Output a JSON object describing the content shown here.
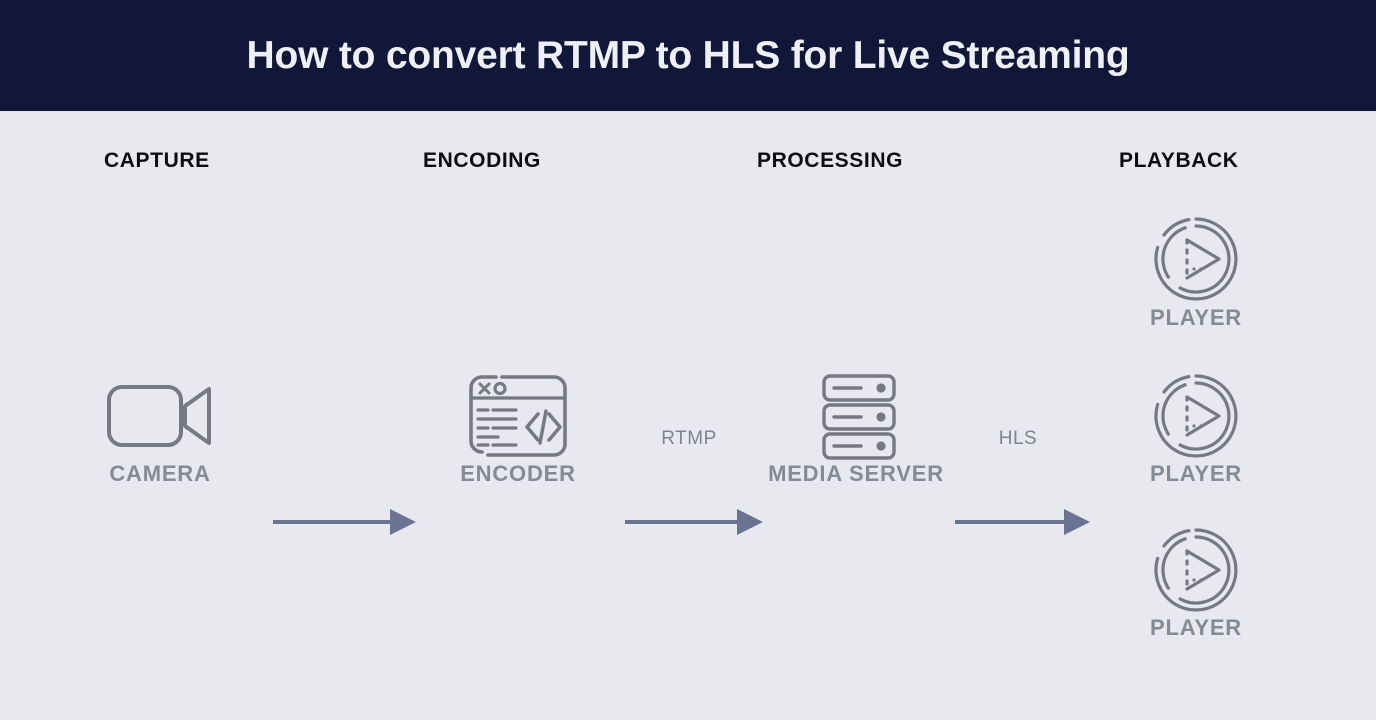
{
  "header": {
    "title": "How to convert RTMP to HLS for Live Streaming",
    "background_color": "#111738",
    "text_color": "#eef0f6"
  },
  "canvas": {
    "background_color": "#e8e9ee"
  },
  "colors": {
    "stage_header_text": "#0b0c10",
    "node_label_text": "#858a93",
    "icon_stroke": "#76797f",
    "arrow": "#6b7392",
    "arrow_label_text": "#7f848d"
  },
  "stages": [
    {
      "id": "capture",
      "label": "CAPTURE"
    },
    {
      "id": "encoding",
      "label": "ENCODING"
    },
    {
      "id": "processing",
      "label": "PROCESSING"
    },
    {
      "id": "playback",
      "label": "PLAYBACK"
    }
  ],
  "nodes": [
    {
      "id": "camera",
      "label": "CAMERA",
      "icon": "video-camera-icon"
    },
    {
      "id": "encoder",
      "label": "ENCODER",
      "icon": "code-window-icon"
    },
    {
      "id": "media-server",
      "label": "MEDIA SERVER",
      "icon": "server-stack-icon"
    },
    {
      "id": "player-top",
      "label": "PLAYER",
      "icon": "play-circle-icon"
    },
    {
      "id": "player-middle",
      "label": "PLAYER",
      "icon": "play-circle-icon"
    },
    {
      "id": "player-bottom",
      "label": "PLAYER",
      "icon": "play-circle-icon"
    }
  ],
  "arrows": [
    {
      "id": "camera-to-encoder",
      "label": ""
    },
    {
      "id": "encoder-to-media-server",
      "label": "RTMP"
    },
    {
      "id": "media-server-to-player",
      "label": "HLS"
    }
  ]
}
